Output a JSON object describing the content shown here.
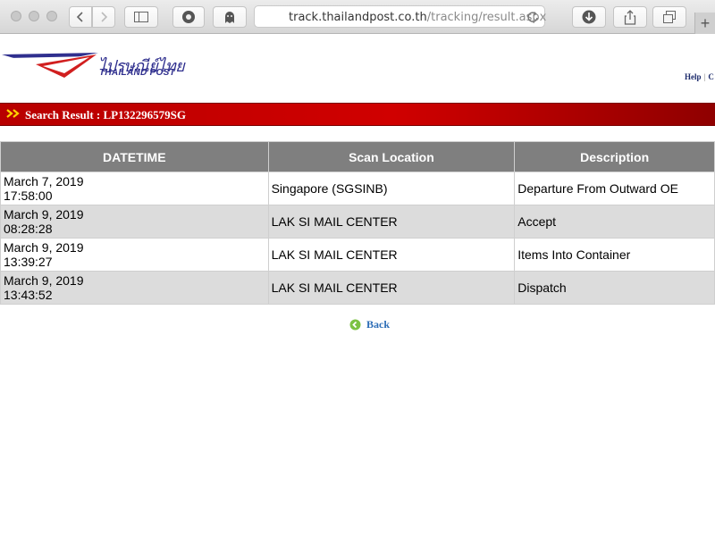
{
  "browser": {
    "url_host": "track.thailandpost.co.th",
    "url_path": "/tracking/result.aspx",
    "new_tab_label": "+"
  },
  "header": {
    "logo_thai": "ไปรษณีย์ไทย",
    "logo_en": "THAILAND POST",
    "help_link": "Help",
    "separator": "|",
    "contact_link_partial": "C"
  },
  "banner": {
    "arrows": "»",
    "title": "Search Result : LP132296579SG"
  },
  "table": {
    "headers": [
      "DATETIME",
      "Scan Location",
      "Description"
    ],
    "rows": [
      {
        "date": "March 7, 2019",
        "time": "17:58:00",
        "location": "Singapore (SGSINB)",
        "description": "Departure From Outward OE"
      },
      {
        "date": "March 9, 2019",
        "time": "08:28:28",
        "location": "LAK SI MAIL CENTER",
        "description": "Accept"
      },
      {
        "date": "March 9, 2019",
        "time": "13:39:27",
        "location": "LAK SI MAIL CENTER",
        "description": "Items Into Container"
      },
      {
        "date": "March 9, 2019",
        "time": "13:43:52",
        "location": "LAK SI MAIL CENTER",
        "description": "Dispatch"
      }
    ]
  },
  "footer": {
    "back_label": "Back"
  },
  "colors": {
    "banner_red": "#c80000",
    "header_gray": "#7f7f7f",
    "row_alt": "#dcdcdc",
    "link_blue": "#2b6cb6"
  }
}
